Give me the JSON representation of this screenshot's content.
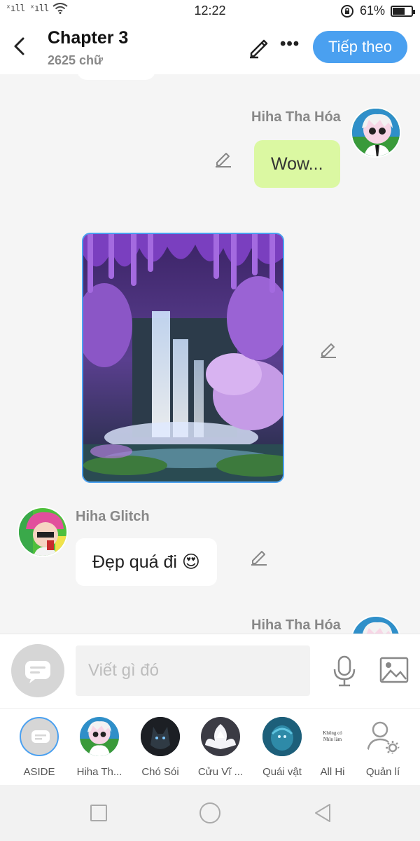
{
  "status_bar": {
    "time": "12:22",
    "battery_label": "61%",
    "battery_level": 0.61,
    "signal_glyphs": "ˣıll ˣıll"
  },
  "header": {
    "title": "Chapter 3",
    "subtitle": "2625 chữ",
    "next_label": "Tiếp theo",
    "more_label": "•••",
    "accent_color": "#4aa0f0"
  },
  "messages": [
    {
      "sender": "Hiha Tha Hóa",
      "side": "right",
      "text": "Wow..."
    },
    {
      "sender": "Hiha Tha Hóa",
      "side": "right",
      "type": "image",
      "image": "waterfall-wisteria-image"
    },
    {
      "sender": "Hiha Glitch",
      "side": "left",
      "text": "Đẹp quá đi 😍"
    },
    {
      "sender": "Hiha Tha Hóa",
      "side": "right",
      "text": ""
    }
  ],
  "input": {
    "placeholder": "Viết gì đó"
  },
  "characters": [
    {
      "label": "ASIDE",
      "icon": "aside-chat-icon"
    },
    {
      "label": "Hiha Th...",
      "icon": "hiha-tha-hoa-avatar"
    },
    {
      "label": "Chó Sói",
      "icon": "wolf-avatar"
    },
    {
      "label": "Cửu Vĩ ...",
      "icon": "nine-tailed-fox-avatar"
    },
    {
      "label": "Quái vật",
      "icon": "sea-monster-avatar"
    },
    {
      "label": "All Hi",
      "icon": "all-hi-avatar",
      "avatar_text": "Không có Nhìn làm"
    },
    {
      "label": "Quản lí",
      "icon": "manage-user-gear-icon"
    }
  ]
}
